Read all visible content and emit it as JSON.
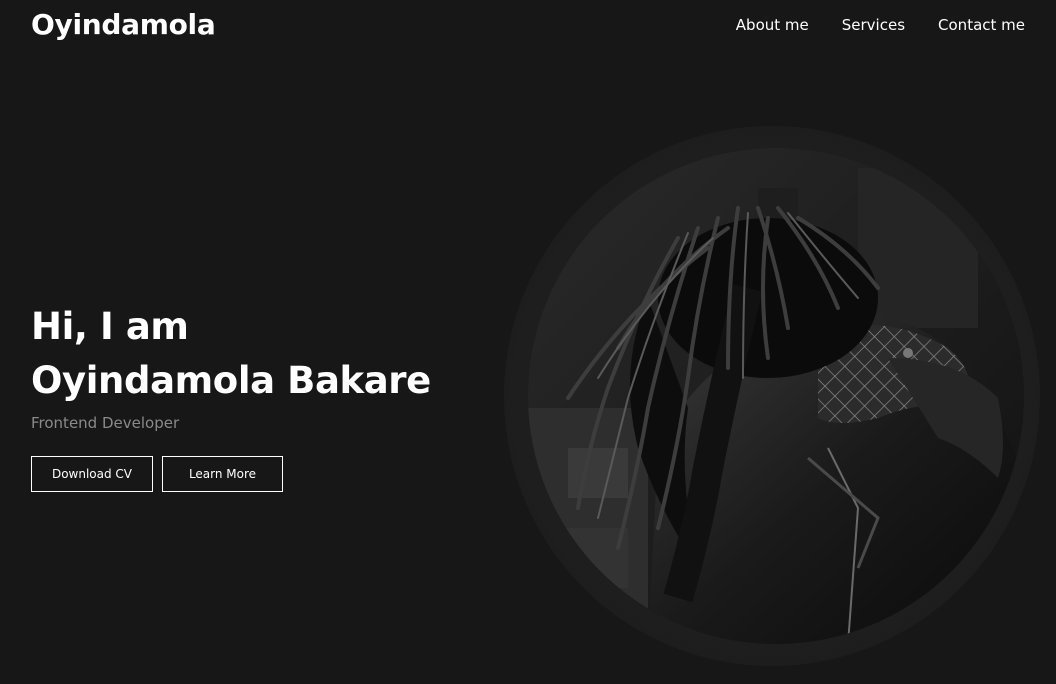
{
  "header": {
    "logo": "Oyindamola",
    "nav": [
      "About me",
      "Services",
      "Contact me"
    ]
  },
  "hero": {
    "greeting": "Hi, I am",
    "name": "Oyindamola Bakare",
    "role": "Frontend Developer",
    "buttons": {
      "download": "Download CV",
      "learn": "Learn More"
    }
  },
  "colors": {
    "background": "#171717",
    "text": "#ffffff",
    "muted": "#8a8a8a"
  },
  "icons": {
    "portrait": "profile-photo"
  }
}
